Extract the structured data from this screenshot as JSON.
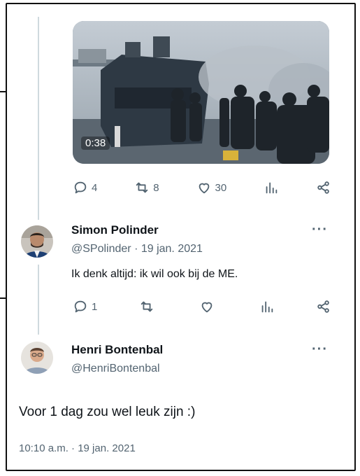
{
  "video": {
    "duration": "0:38"
  },
  "tweet1_actions": {
    "reply_count": "4",
    "retweet_count": "8",
    "like_count": "30"
  },
  "reply1": {
    "name": "Simon Polinder",
    "handle_date": "@SPolinder · 19 jan. 2021",
    "text": "Ik denk altijd: ik wil ook bij de ME.",
    "more": "···",
    "reply_count": "1",
    "retweet_count": "",
    "like_count": ""
  },
  "reply2": {
    "name": "Henri Bontenbal",
    "handle": "@HenriBontenbal",
    "more": "···",
    "text": "Voor 1 dag zou wel leuk zijn :)",
    "timestamp": "10:10 a.m. · 19 jan. 2021"
  },
  "icons": [
    "reply-icon",
    "retweet-icon",
    "like-icon",
    "views-icon",
    "share-icon",
    "more-icon"
  ],
  "colors": {
    "text": "#0f1419",
    "secondary": "#536471",
    "thread_line": "#cfd9de"
  }
}
